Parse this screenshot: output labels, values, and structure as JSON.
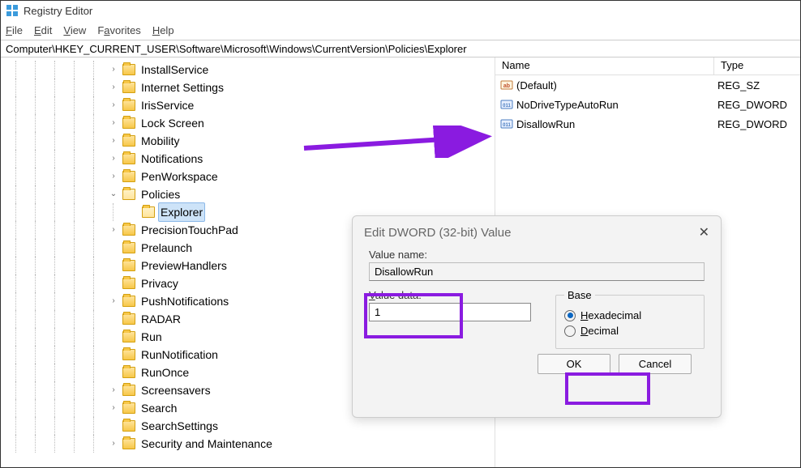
{
  "window": {
    "title": "Registry Editor"
  },
  "menu": {
    "file": "File",
    "edit": "Edit",
    "view": "View",
    "favorites": "Favorites",
    "help": "Help"
  },
  "address": "Computer\\HKEY_CURRENT_USER\\Software\\Microsoft\\Windows\\CurrentVersion\\Policies\\Explorer",
  "tree": {
    "items": [
      {
        "label": "InstallService",
        "chev": ">"
      },
      {
        "label": "Internet Settings",
        "chev": ">"
      },
      {
        "label": "IrisService",
        "chev": ">"
      },
      {
        "label": "Lock Screen",
        "chev": ">"
      },
      {
        "label": "Mobility",
        "chev": ">"
      },
      {
        "label": "Notifications",
        "chev": ">"
      },
      {
        "label": "PenWorkspace",
        "chev": ">"
      },
      {
        "label": "Policies",
        "chev": "v",
        "open": true
      },
      {
        "label": "Explorer",
        "chev": "",
        "child": true,
        "selected": true
      },
      {
        "label": "PrecisionTouchPad",
        "chev": ">"
      },
      {
        "label": "Prelaunch",
        "chev": ""
      },
      {
        "label": "PreviewHandlers",
        "chev": ""
      },
      {
        "label": "Privacy",
        "chev": ""
      },
      {
        "label": "PushNotifications",
        "chev": ">"
      },
      {
        "label": "RADAR",
        "chev": ""
      },
      {
        "label": "Run",
        "chev": ""
      },
      {
        "label": "RunNotification",
        "chev": ""
      },
      {
        "label": "RunOnce",
        "chev": ""
      },
      {
        "label": "Screensavers",
        "chev": ">"
      },
      {
        "label": "Search",
        "chev": ">"
      },
      {
        "label": "SearchSettings",
        "chev": ""
      },
      {
        "label": "Security and Maintenance",
        "chev": ">"
      }
    ]
  },
  "list": {
    "header": {
      "name": "Name",
      "type": "Type"
    },
    "rows": [
      {
        "name": "(Default)",
        "type": "REG_SZ",
        "icon": "sz"
      },
      {
        "name": "NoDriveTypeAutoRun",
        "type": "REG_DWORD",
        "icon": "dw"
      },
      {
        "name": "DisallowRun",
        "type": "REG_DWORD",
        "icon": "dw"
      }
    ]
  },
  "dialog": {
    "title": "Edit DWORD (32-bit) Value",
    "valueNameLabel": "Value name:",
    "valueName": "DisallowRun",
    "valueDataLabel": "Value data:",
    "valueData": "1",
    "baseLabel": "Base",
    "hexLabel": "Hexadecimal",
    "decLabel": "Decimal",
    "ok": "OK",
    "cancel": "Cancel"
  }
}
